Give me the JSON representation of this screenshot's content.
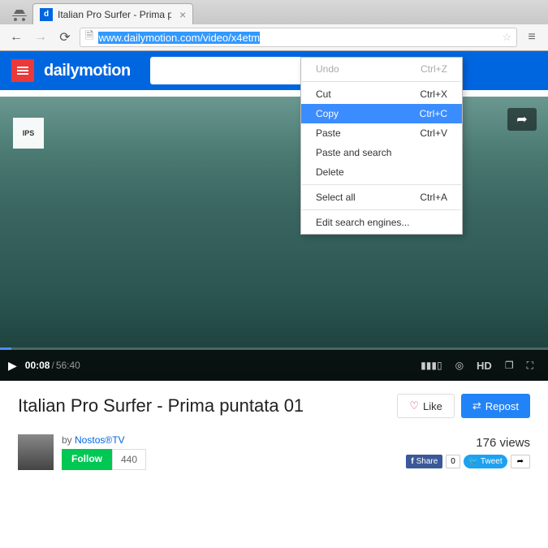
{
  "browser": {
    "tab_title": "Italian Pro Surfer - Prima p",
    "url_prefix": "",
    "url_selected": "www.dailymotion.com/video/x4etm",
    "url_suffix": "…"
  },
  "context_menu": {
    "undo": "Undo",
    "undo_sc": "Ctrl+Z",
    "cut": "Cut",
    "cut_sc": "Ctrl+X",
    "copy": "Copy",
    "copy_sc": "Ctrl+C",
    "paste": "Paste",
    "paste_sc": "Ctrl+V",
    "paste_search": "Paste and search",
    "delete": "Delete",
    "select_all": "Select all",
    "select_all_sc": "Ctrl+A",
    "edit_engines": "Edit search engines..."
  },
  "site": {
    "brand": "dailymotion"
  },
  "player": {
    "watermark": "IPS",
    "current_time": "00:08",
    "duration": "56:40",
    "hd": "HD"
  },
  "video": {
    "title": "Italian Pro Surfer - Prima puntata 01",
    "like_label": "Like",
    "repost_label": "Repost",
    "by_prefix": "by ",
    "channel": "Nostos®TV",
    "follow_label": "Follow",
    "follow_count": "440",
    "views": "176 views",
    "fb_label": "Share",
    "fb_count": "0",
    "tw_label": "Tweet"
  }
}
